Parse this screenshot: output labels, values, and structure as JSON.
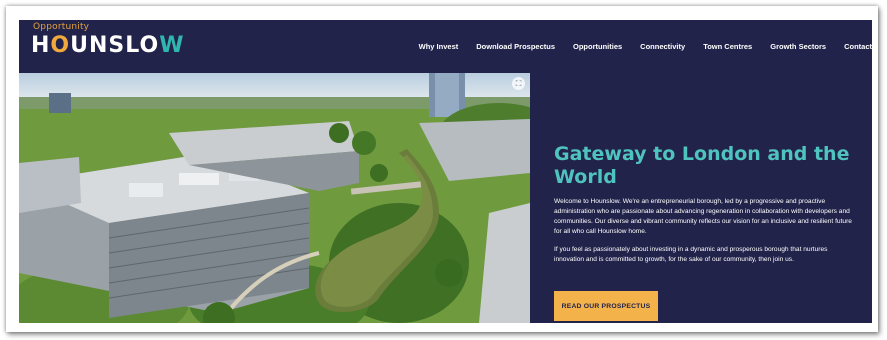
{
  "brand": {
    "tagline": "Opportunity",
    "name_part1": "H",
    "name_o": "O",
    "name_part2": "UNSLO",
    "name_w": "W"
  },
  "nav": {
    "items": [
      "Why Invest",
      "Download Prospectus",
      "Opportunities",
      "Connectivity",
      "Town Centres",
      "Growth Sectors",
      "Contact"
    ]
  },
  "hero": {
    "title": "Gateway to London and the World",
    "paragraph1": "Welcome to Hounslow. We're an entrepreneurial borough, led by a progressive and proactive administration who are passionate about advancing regeneration in collaboration with developers and communities. Our diverse and vibrant community reflects our vision for an inclusive and resilient future for all who call Hounslow home.",
    "paragraph2": "If you feel as passionately about investing in a dynamic and prosperous borough that nurtures innovation and is committed to growth, for the sake of our community, then join us.",
    "cta_label": "READ OUR PROSPECTUS",
    "image_icon": "expand-icon"
  },
  "colors": {
    "navy": "#22234a",
    "teal": "#4fc3bd",
    "amber": "#f4b24a"
  }
}
